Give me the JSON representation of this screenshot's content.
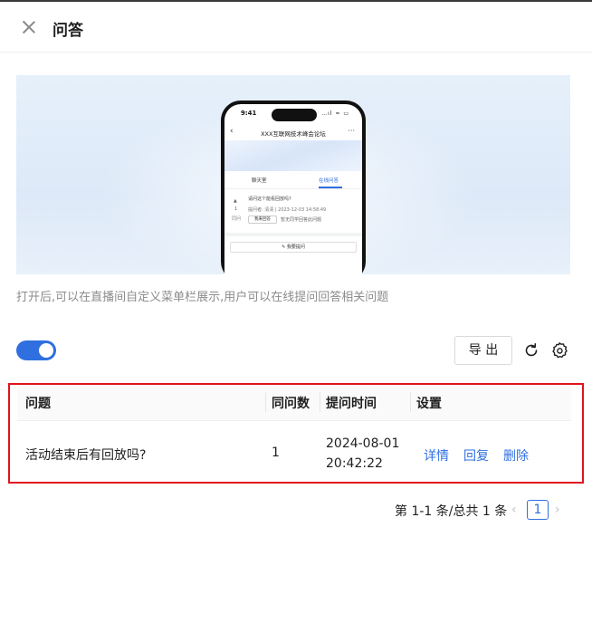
{
  "header": {
    "title": "问答",
    "close_icon": "close-icon"
  },
  "banner": {
    "phone": {
      "time": "9:41",
      "status": "…ıl ≈ ▭",
      "page_title": "XXX互联网技术峰会论坛",
      "more": "···",
      "back": "‹",
      "tabs": [
        "聊天室",
        "在线问答"
      ],
      "question": "请问这个能看回放吗?",
      "asker": "提问者: 清清 | 2023-12-03 14:58:49",
      "vote_count": "1",
      "same_label": "同问",
      "answer_button": "我来回答",
      "answer_placeholder": "暂无同学回答此问题",
      "ask_button": "✎ 我要提问"
    }
  },
  "description": "打开后,可以在直播间自定义菜单栏展示,用户可以在线提问回答相关问题",
  "toggle": {
    "on": true
  },
  "toolbar": {
    "export_label": "导 出",
    "refresh_icon": "refresh-icon",
    "settings_icon": "gear-icon"
  },
  "table": {
    "columns": [
      "问题",
      "同问数",
      "提问时间",
      "设置"
    ],
    "rows": [
      {
        "question": "活动结束后有回放吗?",
        "same_count": "1",
        "date": "2024-08-01",
        "time": "20:42:22",
        "actions": [
          "详情",
          "回复",
          "删除"
        ]
      }
    ]
  },
  "pagination": {
    "summary": "第 1-1 条/总共 1 条",
    "current_page": "1",
    "prev": "‹",
    "next": "›"
  },
  "colors": {
    "accent": "#2f6fe0",
    "highlight_border": "#e0141e"
  }
}
